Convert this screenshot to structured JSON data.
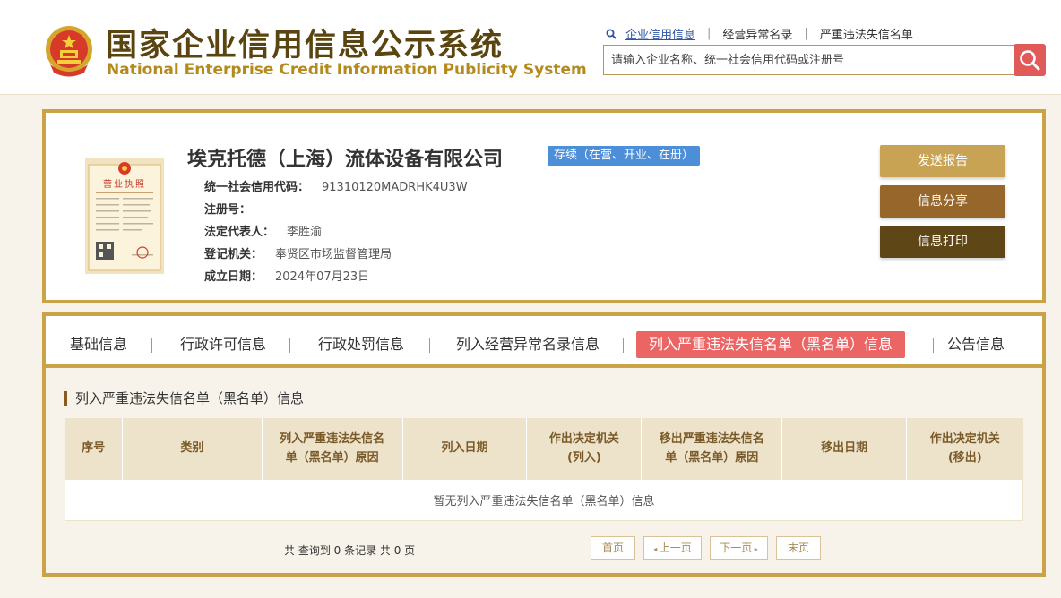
{
  "header": {
    "title_cn": "国家企业信用信息公示系统",
    "title_en": "National Enterprise Credit Information Publicity System",
    "links": [
      "企业信用信息",
      "经营异常名录",
      "严重违法失信名单"
    ],
    "search_placeholder": "请输入企业名称、统一社会信用代码或注册号",
    "icons": {
      "emblem": "national-emblem",
      "magnifier": "magnifier-icon",
      "search": "search-icon"
    }
  },
  "company": {
    "name": "埃克托德（上海）流体设备有限公司",
    "status": "存续（在营、开业、在册）",
    "license_title": "营业执照",
    "fields": [
      {
        "label": "统一社会信用代码：",
        "value": "91310120MADRHK4U3W"
      },
      {
        "label": "注册号：",
        "value": ""
      },
      {
        "label": "法定代表人：",
        "value": "李胜渝"
      },
      {
        "label": "登记机关：",
        "value": "奉贤区市场监督管理局"
      },
      {
        "label": "成立日期：",
        "value": "2024年07月23日"
      }
    ],
    "buttons": {
      "send": "发送报告",
      "share": "信息分享",
      "print": "信息打印"
    }
  },
  "tabs": [
    {
      "label": "基础信息",
      "active": false
    },
    {
      "label": "行政许可信息",
      "active": false
    },
    {
      "label": "行政处罚信息",
      "active": false
    },
    {
      "label": "列入经营异常名录信息",
      "active": false
    },
    {
      "label": "列入严重违法失信名单（黑名单）信息",
      "active": true
    },
    {
      "label": "公告信息",
      "active": false
    }
  ],
  "section": {
    "title": "列入严重违法失信名单（黑名单）信息",
    "columns": [
      [
        "序号"
      ],
      [
        "类别"
      ],
      [
        "列入严重违法失信名",
        "单（黑名单）原因"
      ],
      [
        "列入日期"
      ],
      [
        "作出决定机关",
        "(列入)"
      ],
      [
        "移出严重违法失信名",
        "单（黑名单）原因"
      ],
      [
        "移出日期"
      ],
      [
        "作出决定机关",
        "(移出)"
      ]
    ],
    "empty_message": "暂无列入严重违法失信名单（黑名单）信息",
    "record_count": "共 查询到 0 条记录 共 0 页",
    "pager": {
      "first": "首页",
      "prev": "上一页",
      "next": "下一页",
      "last": "末页"
    }
  },
  "colors": {
    "gold_border": "#c9a346",
    "title_brown": "#5a4410",
    "status_blue": "#4d8ed9",
    "active_tab_red": "#ec6565",
    "search_red": "#e05a5a",
    "btn_send": "#c9a354",
    "btn_share": "#97662a",
    "btn_print": "#5e4617"
  }
}
